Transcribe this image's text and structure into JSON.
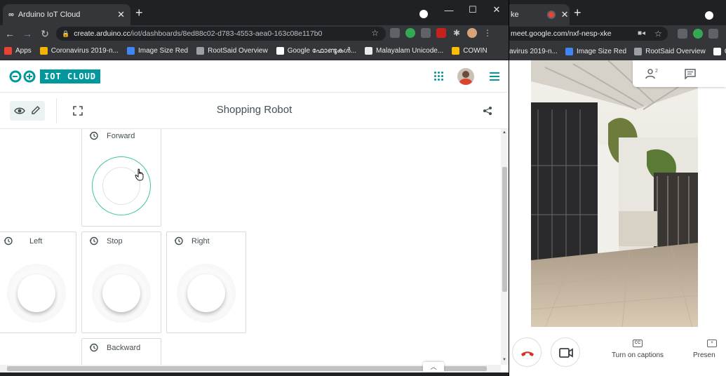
{
  "left_browser": {
    "tab_title": "Arduino IoT Cloud",
    "url_host": "create.arduino.cc",
    "url_path": "/iot/dashboards/8ed88c02-d783-4553-aea0-163c08e117b0",
    "bookmarks": [
      {
        "label": "Apps",
        "color": "#ea4335"
      },
      {
        "label": "Coronavirus 2019-n...",
        "color": "#f4b400"
      },
      {
        "label": "Image Size Red",
        "color": "#4285f4"
      },
      {
        "label": "RootSaid Overview",
        "color": "#9aa0a6"
      },
      {
        "label": "Google ഫോണ്ടുകൾ...",
        "color": "#ffffff"
      },
      {
        "label": "Malayalam Unicode...",
        "color": "#e8eaed"
      },
      {
        "label": "COWIN",
        "color": "#fbbc04"
      }
    ]
  },
  "iot": {
    "badge": "IOT CLOUD",
    "dashboard_title": "Shopping Robot",
    "brand_color": "#00979d",
    "widgets": [
      {
        "label": "Forward",
        "state": "pressed"
      },
      {
        "label": "Left",
        "state": "idle"
      },
      {
        "label": "Stop",
        "state": "idle"
      },
      {
        "label": "Right",
        "state": "idle"
      },
      {
        "label": "Backward",
        "state": "idle"
      }
    ]
  },
  "right_browser": {
    "tab_title_fragment": "ke",
    "url": "meet.google.com/nxf-nesp-xke",
    "bookmarks": [
      "avirus 2019-n...",
      "Image Size Red",
      "RootSaid Overview",
      "Goog"
    ],
    "people_count": "2",
    "captions_label": "Turn on captions",
    "present_label": "Presen"
  }
}
